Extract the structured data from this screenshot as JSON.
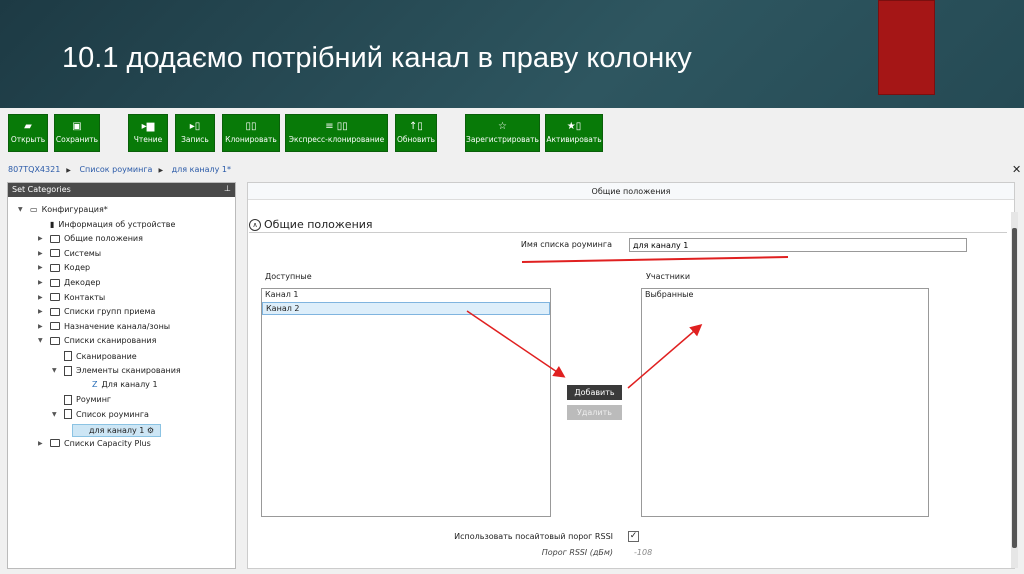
{
  "slide": {
    "title": "10.1 додаємо потрібний канал в праву колонку",
    "accent": "#a51616"
  },
  "toolbar": [
    {
      "label": "Открыть",
      "icon": "folder-icon"
    },
    {
      "label": "Сохранить",
      "icon": "save-icon"
    },
    {
      "label": "Чтение",
      "icon": "read-icon"
    },
    {
      "label": "Запись",
      "icon": "write-icon"
    },
    {
      "label": "Клонировать",
      "icon": "clone-icon"
    },
    {
      "label": "Экспресс-клонирование",
      "icon": "express-clone-icon"
    },
    {
      "label": "Обновить",
      "icon": "update-icon"
    },
    {
      "label": "Зарегистрировать",
      "icon": "star-icon"
    },
    {
      "label": "Активировать",
      "icon": "activate-icon"
    }
  ],
  "breadcrumb": [
    "807TQX4321",
    "Список роуминга",
    "для каналу 1*"
  ],
  "left": {
    "header": "Set Categories",
    "tree": [
      "Конфигурация*",
      "Информация об устройстве",
      "Общие положения",
      "Системы",
      "Кодер",
      "Декодер",
      "Контакты",
      "Списки групп приема",
      "Назначение канала/зоны",
      "Списки сканирования",
      "Сканирование",
      "Элементы сканирования",
      "Для каналу 1",
      "Роуминг",
      "Список роуминга",
      "для каналу 1",
      "Списки Capacity Plus"
    ]
  },
  "right": {
    "header": "Общие положения",
    "section": "Общие положения",
    "name_label": "Имя списка роуминга",
    "name_value": "для каналу 1",
    "available_label": "Доступные",
    "available": [
      "Канал 1",
      "Канал 2"
    ],
    "members_label": "Участники",
    "members": [
      "Выбранные"
    ],
    "add": "Добавить",
    "remove": "Удалить",
    "rssi_check_label": "Использовать посайтовый порог RSSI",
    "rssi_checked": true,
    "rssi_label": "Порог RSSI (дБм)",
    "rssi_value": "-108"
  }
}
